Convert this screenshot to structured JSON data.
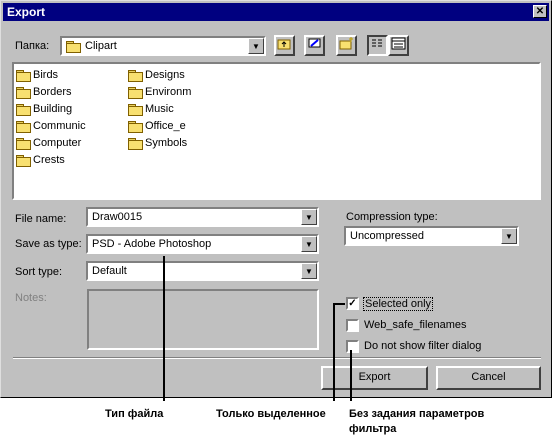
{
  "window": {
    "title": "Export",
    "close_glyph": "✕"
  },
  "lookin": {
    "label": "Папка:",
    "value": "Clipart"
  },
  "folders": {
    "col1": [
      "Birds",
      "Borders",
      "Building",
      "Communic",
      "Computer",
      "Crests"
    ],
    "col2": [
      "Designs",
      "Environm",
      "Music",
      "Office_e",
      "Symbols"
    ]
  },
  "form": {
    "file_name_label": "File name:",
    "file_name_value": "Draw0015",
    "save_type_label": "Save as type:",
    "save_type_value": "PSD - Adobe Photoshop",
    "sort_label": "Sort type:",
    "sort_value": "Default",
    "notes_label": "Notes:",
    "compression_label": "Compression type:",
    "compression_value": "Uncompressed"
  },
  "options": {
    "selected_only": "Selected only",
    "web_safe": "Web_safe_filenames",
    "no_filter": "Do not show filter dialog",
    "selected_only_checked": true
  },
  "buttons": {
    "export": "Export",
    "cancel": "Cancel"
  },
  "callouts": {
    "file_type": "Тип файла",
    "selected_only": "Только выделенное",
    "no_filter_line1": "Без задания параметров",
    "no_filter_line2": "фильтра"
  }
}
